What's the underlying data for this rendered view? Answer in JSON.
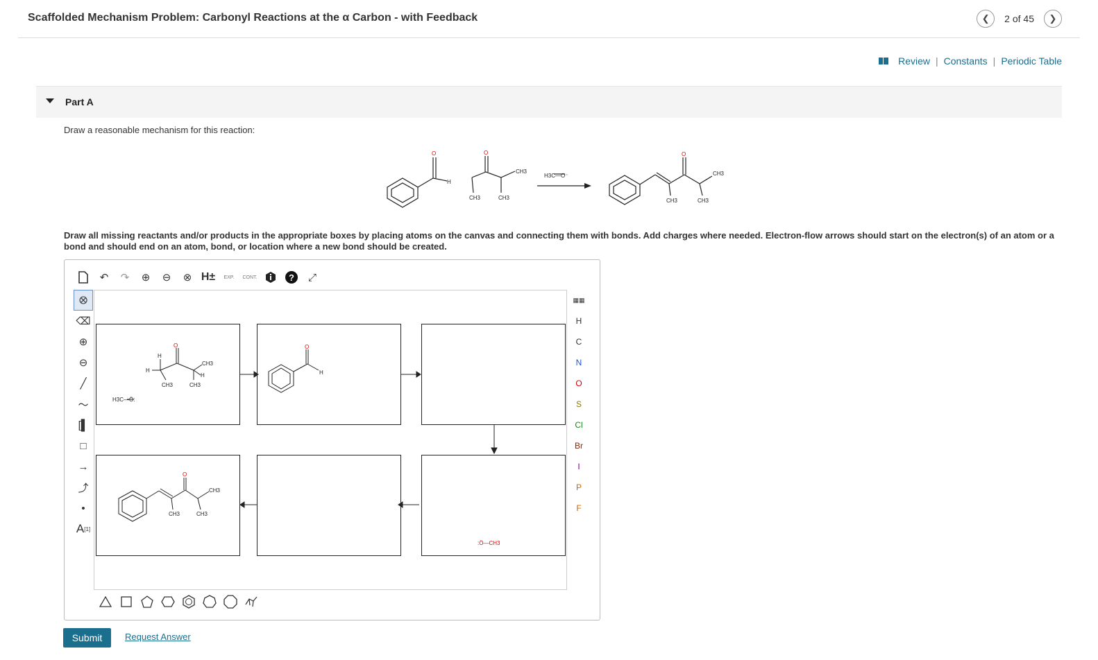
{
  "header": {
    "title": "Scaffolded Mechanism Problem: Carbonyl Reactions at the α Carbon - with Feedback",
    "prev_icon": "chevron-left-icon",
    "next_icon": "chevron-right-icon",
    "position": "2 of 45"
  },
  "resources": {
    "review": "Review",
    "constants": "Constants",
    "periodic_table": "Periodic Table",
    "separator": "|"
  },
  "part": {
    "label": "Part A",
    "prompt": "Draw a reasonable mechanism for this reaction:",
    "instructions": "Draw all missing reactants and/or products in the appropriate boxes by placing atoms on the canvas and connecting them with bonds. Add charges where needed. Electron-flow arrows should start on the electron(s) of an atom or a bond and should end on an atom, bond, or location where a new bond should be created."
  },
  "scheme": {
    "o": "O",
    "h": "H",
    "ch3": "CH3",
    "reagent": "H3C—O⁻"
  },
  "editor": {
    "top_tools": [
      "new-document-icon",
      "undo-icon",
      "redo-icon",
      "zoom-in-icon",
      "zoom-out-icon",
      "zoom-reset-icon",
      "h-toggle",
      "exp-icon",
      "cont-icon",
      "info-icon",
      "help-icon",
      "fullscreen-icon"
    ],
    "h_label": "H±",
    "exp_label": "EXP.",
    "cont_label": "CONT.",
    "elements": [
      {
        "symbol": "H",
        "color": "#333333"
      },
      {
        "symbol": "C",
        "color": "#333333"
      },
      {
        "symbol": "N",
        "color": "#2255cc"
      },
      {
        "symbol": "O",
        "color": "#d00000"
      },
      {
        "symbol": "S",
        "color": "#8a7a00"
      },
      {
        "symbol": "Cl",
        "color": "#1a8a1a"
      },
      {
        "symbol": "Br",
        "color": "#8a2a00"
      },
      {
        "symbol": "I",
        "color": "#8a008a"
      },
      {
        "symbol": "P",
        "color": "#cc6600"
      },
      {
        "symbol": "F",
        "color": "#cc6600"
      }
    ],
    "text_tool_label": "A",
    "text_tool_sup": "[1]",
    "box_labels": {
      "methoxide": "H3C—Ö:",
      "methanol": ":Ö—CH3",
      "h": "H",
      "ch3": "CH3",
      "o": "O"
    }
  },
  "actions": {
    "submit": "Submit",
    "request_answer": "Request Answer"
  }
}
